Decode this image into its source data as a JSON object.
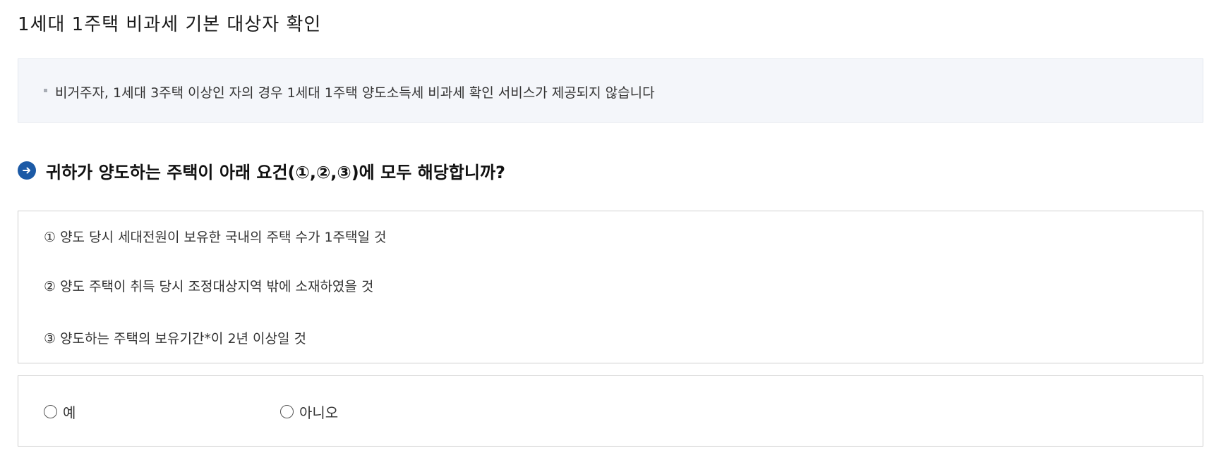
{
  "page_title": "1세대 1주택 비과세 기본 대상자 확인",
  "notice": {
    "text": "비거주자, 1세대 3주택 이상인 자의 경우 1세대 1주택 양도소득세 비과세 확인 서비스가 제공되지 않습니다"
  },
  "question": {
    "icon": "arrow-circle-icon",
    "text": "귀하가 양도하는 주택이 아래 요건(①,②,③)에 모두 해당합니까?"
  },
  "requirements": [
    "① 양도 당시 세대전원이 보유한 국내의 주택 수가 1주택일 것",
    "② 양도 주택이 취득 당시 조정대상지역 밖에 소재하였을 것",
    "③ 양도하는 주택의 보유기간*이 2년 이상일 것"
  ],
  "answer": {
    "yes_label": "예",
    "no_label": "아니오",
    "selected": null
  },
  "colors": {
    "accent": "#1c5aa6",
    "notice_bg": "#f4f6fa",
    "border": "#cfcfcf"
  }
}
